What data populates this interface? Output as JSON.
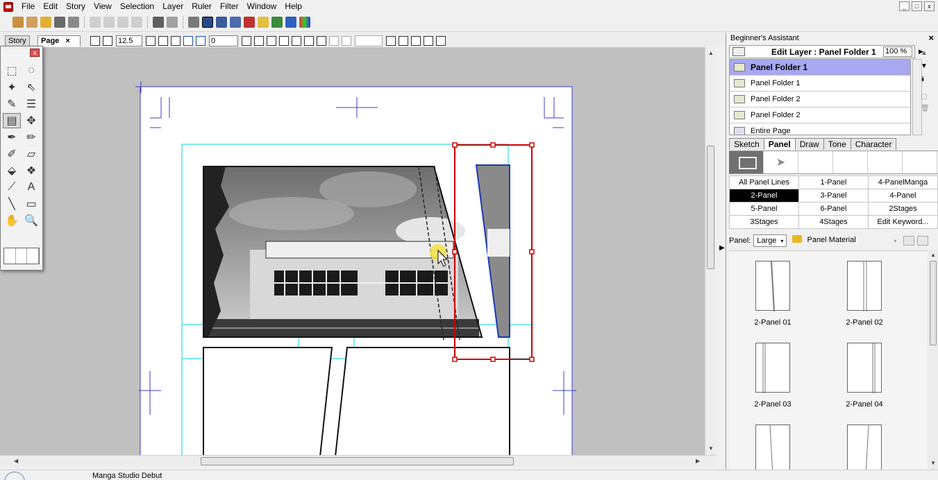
{
  "menu": [
    "File",
    "Edit",
    "Story",
    "View",
    "Selection",
    "Layer",
    "Ruler",
    "Filter",
    "Window",
    "Help"
  ],
  "window_controls": [
    "_",
    "□",
    "x"
  ],
  "doc_tabs": {
    "story": "Story",
    "page": "Page",
    "page_close": "×"
  },
  "tool_options": {
    "stroke_value": "12.5",
    "rotate_value": "0"
  },
  "tool_box": {
    "close_label": "x"
  },
  "assistant": {
    "title": "Beginner's Assistant",
    "close": "×",
    "layer_header": "Edit Layer : Panel Folder 1",
    "zoom": "100 %",
    "layers": [
      {
        "label": "Panel Folder 1",
        "selected": true
      },
      {
        "label": "Panel Folder 1",
        "selected": false
      },
      {
        "label": "Panel Folder 2",
        "selected": false
      },
      {
        "label": "Panel Folder 2",
        "selected": false
      },
      {
        "label": "Entire Page",
        "selected": false
      }
    ],
    "mode_tabs": [
      "Sketch",
      "Panel",
      "Draw",
      "Tone",
      "Character"
    ],
    "active_tab": "Panel",
    "categories": [
      "All Panel Lines",
      "1-Panel",
      "4-PanelManga",
      "2-Panel",
      "3-Panel",
      "4-Panel",
      "5-Panel",
      "6-Panel",
      "2Stages",
      "3Stages",
      "4Stages",
      "Edit Keyword..."
    ],
    "selected_category": "2-Panel",
    "panel_label": "Panel:",
    "size_select": "Large",
    "material_select": "Panel Material",
    "thumbnails": [
      "2-Panel 01",
      "2-Panel 02",
      "2-Panel 03",
      "2-Panel 04"
    ]
  },
  "status": {
    "app_name": "Manga Studio Debut"
  },
  "colors": {
    "selection_red": "#d00000",
    "guide_cyan": "#00d8d8",
    "frame_blue": "#2020c0",
    "layer_highlight": "#a8a8f0"
  }
}
